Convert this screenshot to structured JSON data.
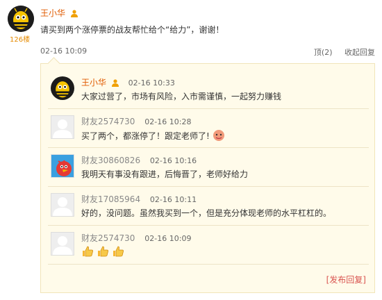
{
  "post": {
    "author": "王小华",
    "floor": "126楼",
    "text": "请买到两个涨停票的战友帮忙给个“给力”，谢谢！",
    "time": "02-16 10:09",
    "actions": {
      "top": "顶(2)",
      "collapse": "收起回复"
    }
  },
  "replies": [
    {
      "name": "王小华",
      "time": "02-16 10:33",
      "text": "大家过营了，市场有风险，入市需谨慎，一起努力赚钱",
      "avatar": "bee-avatar-icon"
    },
    {
      "name": "财友2574730",
      "time": "02-16 10:28",
      "text": "买了两个，都涨停了！跟定老师了!",
      "avatar": "default-avatar-icon"
    },
    {
      "name": "财友30860826",
      "time": "02-16 10:16",
      "text": "我明天有事没有跟进，后悔晋了，老师好给力",
      "avatar": "angry-bird-avatar-icon"
    },
    {
      "name": "财友17085964",
      "time": "02-16 10:11",
      "text": "好的，没问题。虽然我买到一个，但是充分体现老师的水平杠杠的。",
      "avatar": "default-avatar-icon"
    },
    {
      "name": "财友2574730",
      "time": "02-16 10:09",
      "text": "",
      "avatar": "default-avatar-icon"
    }
  ],
  "publish_label": "[发布回复]"
}
